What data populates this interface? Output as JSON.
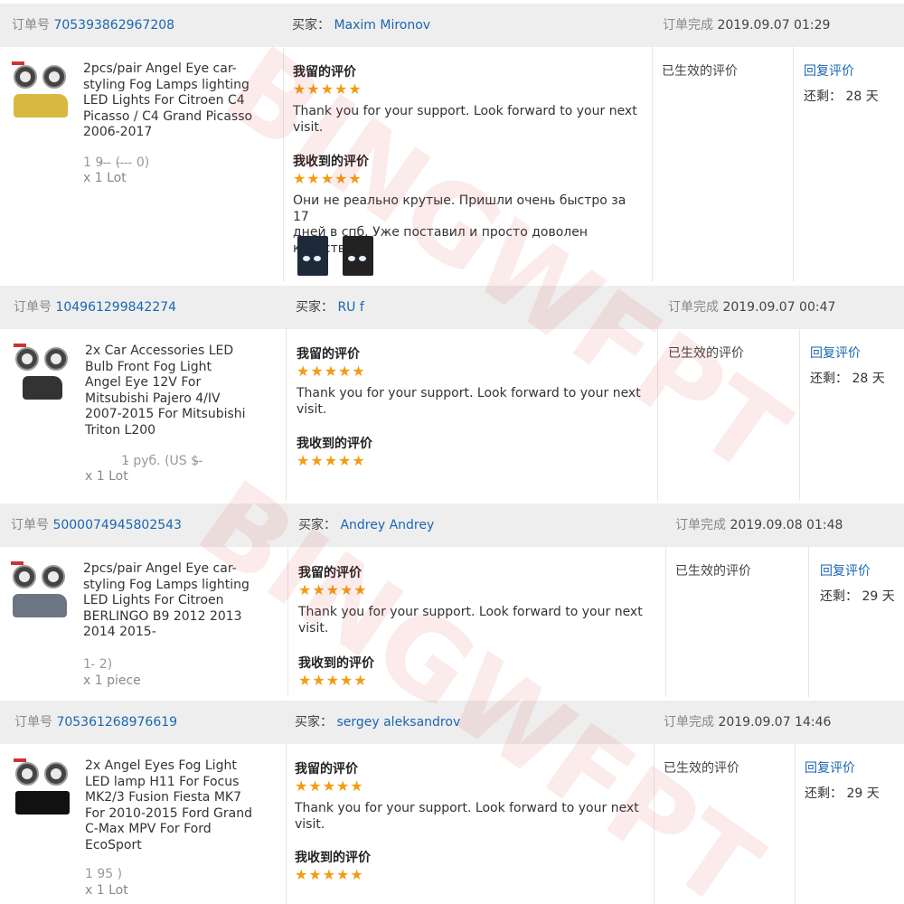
{
  "labels": {
    "order_no": "订单号",
    "buyer": "买家：",
    "completed": "订单完成",
    "my_review": "我留的评价",
    "received_review": "我收到的评价",
    "effective": "已生效的评价",
    "reply": "回复评价",
    "remaining": "还剩："
  },
  "watermark": "BINGWFPT",
  "colors": {
    "link": "#1a66b3",
    "star": "#f39c12",
    "header_bg": "#eeeeee"
  },
  "orders": [
    {
      "order_no": "705393862967208",
      "buyer": "Maxim Mironov",
      "completed_at": "2019.09.07 01:29",
      "title_lines": [
        "2pcs/pair Angel Eye car-",
        "styling Fog Lamps lighting",
        "LED Lights For Citroen C4",
        "Picasso / C4 Grand Picasso",
        "2006-2017"
      ],
      "price": "1 9̵ ̵ ̵ (̵ ̵ ̵ ̵ 0)",
      "qty": "x 1 Lot",
      "my_stars": "★★★★★",
      "my_text_lines": [
        "Thank you for your support. Look forward to your next",
        "visit."
      ],
      "received_stars": "★★★★★",
      "received_text_lines": [
        "Они не реально крутые. Пришли очень быстро за 17",
        "дней в спб. Уже поставил и просто доволен качеством"
      ],
      "days_left": "28 天"
    },
    {
      "order_no": "104961299842274",
      "buyer": "RU f",
      "completed_at": "2019.09.07 00:47",
      "title_lines": [
        "2x Car Accessories LED",
        "Bulb Front Fog Light",
        "Angel Eye 12V For",
        "Mitsubishi Pajero 4/IV",
        "2007-2015 For Mitsubishi",
        "Triton L200"
      ],
      "price": "1̵ руб. (US $̵ ̵",
      "qty": "x 1 Lot",
      "my_stars": "★★★★★",
      "my_text_lines": [
        "Thank you for your support. Look forward to your next",
        "visit."
      ],
      "received_stars": "★★★★★",
      "received_text_lines": [],
      "days_left": "28 天"
    },
    {
      "order_no": "5000074945802543",
      "buyer": "Andrey Andrey",
      "completed_at": "2019.09.08 01:48",
      "title_lines": [
        "2pcs/pair Angel Eye car-",
        "styling Fog Lamps lighting",
        "LED Lights For Citroen",
        "BERLINGO B9 2012 2013",
        "2014 2015-"
      ],
      "price": "1 ̵            2)",
      "qty": "x 1 piece",
      "my_stars": "★★★★★",
      "my_text_lines": [
        "Thank you for your support. Look forward to your next",
        "visit."
      ],
      "received_stars": "★★★★★",
      "received_text_lines": [],
      "days_left": "29 天"
    },
    {
      "order_no": "705361268976619",
      "buyer": "sergey aleksandrov",
      "completed_at": "2019.09.07 14:46",
      "title_lines": [
        "2x Angel Eyes Fog Light",
        "LED lamp H11 For Focus",
        "MK2/3 Fusion Fiesta MK7",
        "For 2010-2015 Ford Grand",
        "C-Max MPV For Ford",
        "EcoSport"
      ],
      "price": "1 95            )",
      "qty": "x 1 Lot",
      "my_stars": "★★★★★",
      "my_text_lines": [
        "Thank you for your support. Look forward to your next",
        "visit."
      ],
      "received_stars": "★★★★★",
      "received_text_lines": [],
      "days_left": "29 天"
    }
  ]
}
